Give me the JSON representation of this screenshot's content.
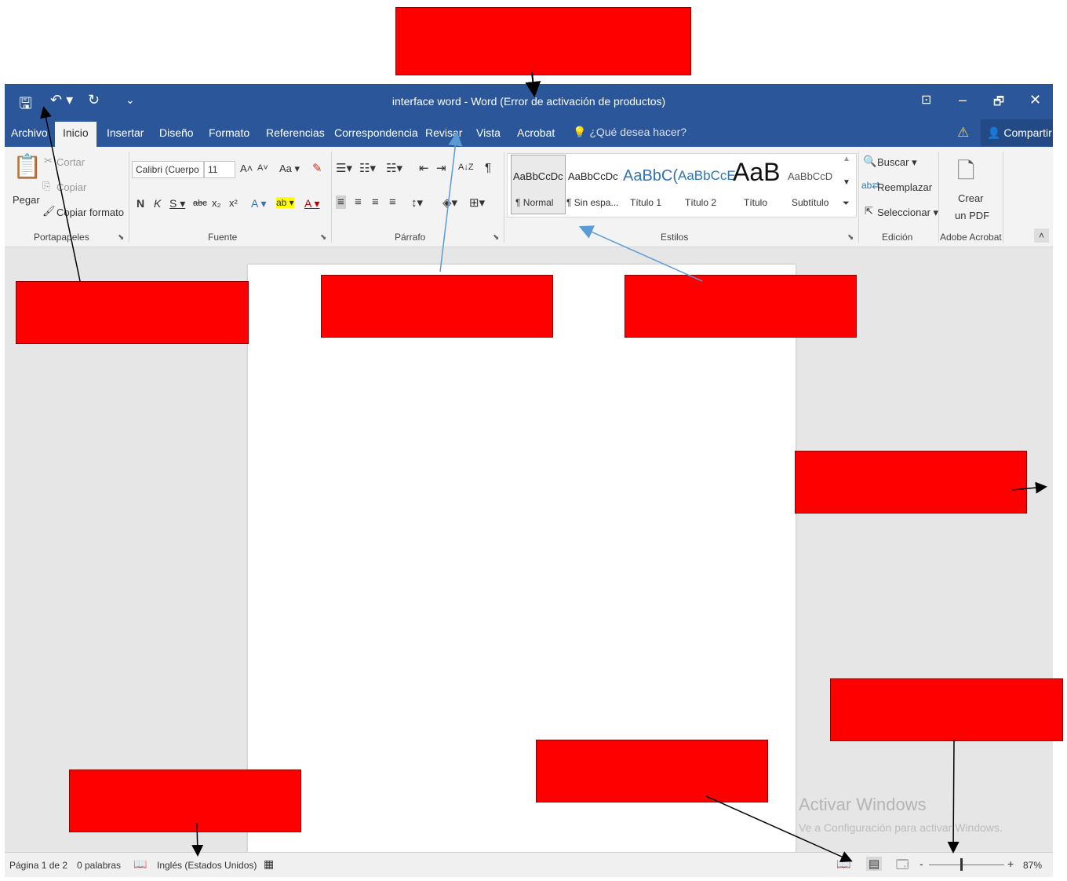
{
  "window": {
    "title": "interface word - Word (Error de activación de productos)",
    "quick_access": {
      "save": "🖫",
      "undo": "↶ ▾",
      "redo": "↻",
      "customize": "⌄"
    },
    "controls": {
      "ribbon_options": "⊡",
      "minimize": "–",
      "restore": "🗗",
      "close": "✕"
    }
  },
  "tabs": [
    {
      "label": "Archivo"
    },
    {
      "label": "Inicio"
    },
    {
      "label": "Insertar"
    },
    {
      "label": "Diseño"
    },
    {
      "label": "Formato"
    },
    {
      "label": "Referencias"
    },
    {
      "label": "Correspondencia"
    },
    {
      "label": "Revisar"
    },
    {
      "label": "Vista"
    },
    {
      "label": "Acrobat"
    }
  ],
  "tell_me": "¿Qué desea hacer?",
  "share": "Compartir",
  "ribbon": {
    "clipboard": {
      "paste": "Pegar",
      "cut": "Cortar",
      "copy": "Copiar",
      "format_painter": "Copiar formato",
      "group_label": "Portapapeles"
    },
    "font": {
      "font_name": "Calibri (Cuerpo",
      "font_size": "11",
      "grow": "A˄",
      "shrink": "A˅",
      "change_case": "Aa ▾",
      "bold": "N",
      "italic": "K",
      "underline": "S ▾",
      "strikethrough": "abc",
      "subscript": "x₂",
      "superscript": "x²",
      "text_effects": "A ▾",
      "highlight": "ab ▾",
      "font_color": "A ▾",
      "group_label": "Fuente"
    },
    "paragraph": {
      "show_marks": "¶",
      "sort": "A↓Z",
      "group_label": "Párrafo"
    },
    "styles": {
      "items": [
        {
          "preview": "AaBbCcDc",
          "name": "¶ Normal"
        },
        {
          "preview": "AaBbCcDc",
          "name": "¶ Sin espa..."
        },
        {
          "preview": "AaBbC(",
          "name": "Título 1"
        },
        {
          "preview": "AaBbCcE",
          "name": "Título 2"
        },
        {
          "preview": "AaB",
          "name": "Título"
        },
        {
          "preview": "AaBbCcD",
          "name": "Subtítulo"
        }
      ],
      "group_label": "Estilos"
    },
    "editing": {
      "find": "Buscar ▾",
      "replace": "Reemplazar",
      "select": "Seleccionar ▾",
      "group_label": "Edición"
    },
    "acrobat": {
      "create_pdf_line1": "Crear",
      "create_pdf_line2": "un PDF",
      "group_label": "Adobe Acrobat"
    }
  },
  "watermark": {
    "line1": "Activar Windows",
    "line2": "Ve a Configuración para activar Windows."
  },
  "status": {
    "page": "Página 1 de 2",
    "words": "0 palabras",
    "language": "Inglés (Estados Unidos)",
    "zoom_minus": "-",
    "zoom_plus": "+",
    "zoom": "87%"
  },
  "colors": {
    "title_blue": "#2b579a",
    "annotation_red": "#ff0000"
  }
}
